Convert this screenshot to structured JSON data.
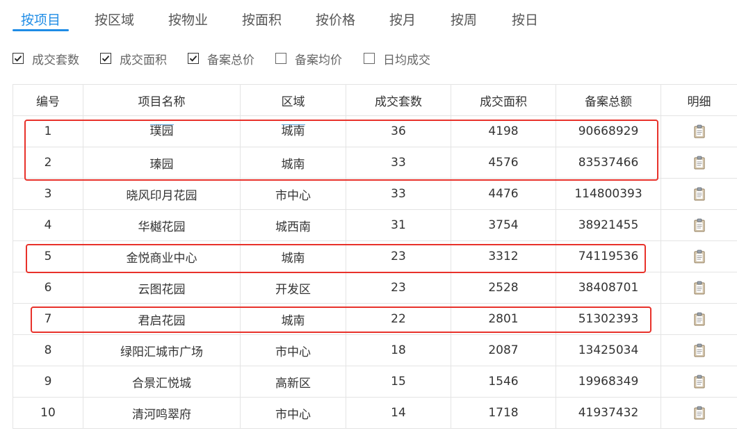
{
  "tabs": [
    {
      "label": "按项目",
      "active": true
    },
    {
      "label": "按区域",
      "active": false
    },
    {
      "label": "按物业",
      "active": false
    },
    {
      "label": "按面积",
      "active": false
    },
    {
      "label": "按价格",
      "active": false
    },
    {
      "label": "按月",
      "active": false
    },
    {
      "label": "按周",
      "active": false
    },
    {
      "label": "按日",
      "active": false
    }
  ],
  "filters": [
    {
      "label": "成交套数",
      "checked": true
    },
    {
      "label": "成交面积",
      "checked": true
    },
    {
      "label": "备案总价",
      "checked": true
    },
    {
      "label": "备案均价",
      "checked": false
    },
    {
      "label": "日均成交",
      "checked": false
    }
  ],
  "table": {
    "headers": [
      "编号",
      "项目名称",
      "区域",
      "成交套数",
      "成交面积",
      "备案总额",
      "明细"
    ],
    "rows": [
      [
        "1",
        "璞园",
        "城南",
        "36",
        "4198",
        "90668929"
      ],
      [
        "2",
        "瑧园",
        "城南",
        "33",
        "4576",
        "83537466"
      ],
      [
        "3",
        "晓风印月花园",
        "市中心",
        "33",
        "4476",
        "114800393"
      ],
      [
        "4",
        "华樾花园",
        "城西南",
        "31",
        "3754",
        "38921455"
      ],
      [
        "5",
        "金悦商业中心",
        "城南",
        "23",
        "3312",
        "74119536"
      ],
      [
        "6",
        "云图花园",
        "开发区",
        "23",
        "2528",
        "38408701"
      ],
      [
        "7",
        "君启花园",
        "城南",
        "22",
        "2801",
        "51302393"
      ],
      [
        "8",
        "绿阳汇城市广场",
        "市中心",
        "18",
        "2087",
        "13425034"
      ],
      [
        "9",
        "合景汇悦城",
        "高新区",
        "15",
        "1546",
        "19968349"
      ],
      [
        "10",
        "清河鸣翠府",
        "市中心",
        "14",
        "1718",
        "41937432"
      ]
    ],
    "detail_icon": "clipboard-icon"
  },
  "colors": {
    "accent": "#1f8ce6",
    "highlight": "#e8312a",
    "border": "#e4e4e4"
  }
}
